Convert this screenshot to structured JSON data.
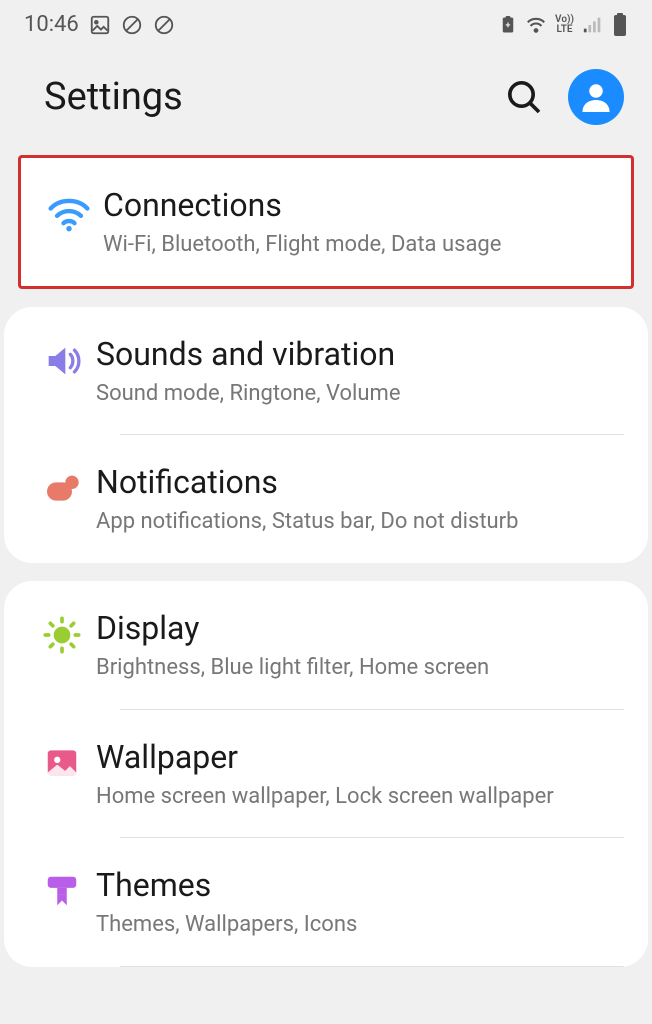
{
  "status": {
    "time": "10:46",
    "volte": "LTE",
    "vo": "Vo))"
  },
  "header": {
    "title": "Settings"
  },
  "settings": {
    "connections": {
      "title": "Connections",
      "desc": "Wi-Fi, Bluetooth, Flight mode, Data usage"
    },
    "sounds": {
      "title": "Sounds and vibration",
      "desc": "Sound mode, Ringtone, Volume"
    },
    "notifications": {
      "title": "Notifications",
      "desc": "App notifications, Status bar, Do not disturb"
    },
    "display": {
      "title": "Display",
      "desc": "Brightness, Blue light filter, Home screen"
    },
    "wallpaper": {
      "title": "Wallpaper",
      "desc": "Home screen wallpaper, Lock screen wallpaper"
    },
    "themes": {
      "title": "Themes",
      "desc": "Themes, Wallpapers, Icons"
    }
  }
}
